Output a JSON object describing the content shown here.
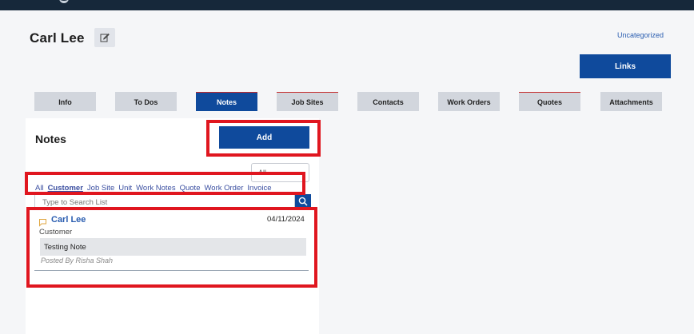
{
  "header": {
    "title": "Carl Lee",
    "category": "Uncategorized"
  },
  "links_button": "Links",
  "tabs": [
    {
      "label": "Info"
    },
    {
      "label": "To Dos"
    },
    {
      "label": "Notes"
    },
    {
      "label": "Job Sites"
    },
    {
      "label": "Contacts"
    },
    {
      "label": "Work Orders"
    },
    {
      "label": "Quotes"
    },
    {
      "label": "Attachments"
    }
  ],
  "notes_panel": {
    "title": "Notes",
    "add_label": "Add",
    "select_value": "All",
    "filters": [
      "All",
      "Customer",
      "Job Site",
      "Unit",
      "Work Notes",
      "Quote",
      "Work Order",
      "Invoice"
    ],
    "active_filter": "Customer",
    "search_placeholder": "Type to Search List",
    "notes": [
      {
        "author": "Carl Lee",
        "date": "04/11/2024",
        "type": "Customer",
        "body": "Testing Note",
        "posted_by": "Posted By Risha Shah"
      }
    ]
  },
  "colors": {
    "primary": "#0f4a9c",
    "highlight": "#e0161f",
    "topbar": "#16283a"
  }
}
